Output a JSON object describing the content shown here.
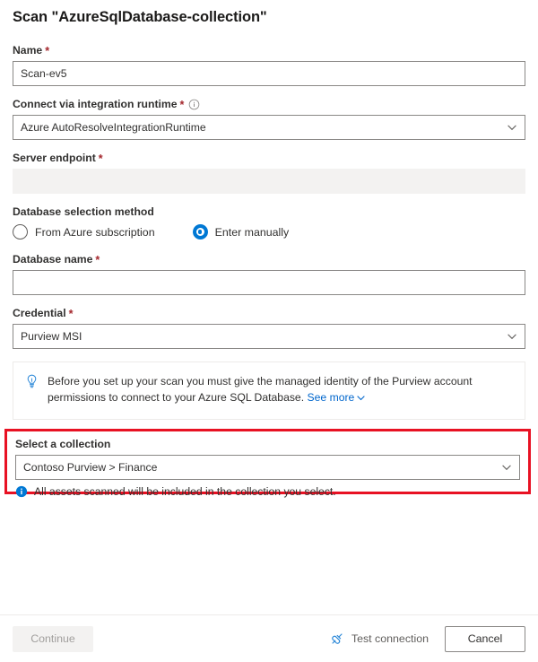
{
  "dialog": {
    "title": "Scan \"AzureSqlDatabase-collection\""
  },
  "fields": {
    "name": {
      "label": "Name",
      "required_mark": "*",
      "value": "Scan-ev5",
      "placeholder": ""
    },
    "integration_runtime": {
      "label": "Connect via integration runtime",
      "required_mark": "*",
      "info_icon": "info-circle-icon",
      "value": "Azure AutoResolveIntegrationRuntime",
      "chevron_icon": "chevron-down-icon"
    },
    "server_endpoint": {
      "label": "Server endpoint",
      "required_mark": "*",
      "value": "",
      "disabled": true
    },
    "database_selection_method": {
      "label": "Database selection method",
      "options": [
        {
          "label": "From Azure subscription",
          "selected": false
        },
        {
          "label": "Enter manually",
          "selected": true
        }
      ]
    },
    "database_name": {
      "label": "Database name",
      "required_mark": "*",
      "value": "",
      "placeholder": ""
    },
    "credential": {
      "label": "Credential",
      "required_mark": "*",
      "value": "Purview MSI",
      "chevron_icon": "chevron-down-icon"
    }
  },
  "tip": {
    "icon": "lightbulb-icon",
    "text": "Before you set up your scan you must give the managed identity of the Purview account permissions to connect to your Azure SQL Database.",
    "link_label": "See more",
    "link_chevron_icon": "chevron-down-icon"
  },
  "collection_section": {
    "label": "Select a collection",
    "value": "Contoso Purview > Finance",
    "chevron_icon": "chevron-down-icon",
    "note_icon": "info-filled-icon",
    "note_text": "All assets scanned will be included in the collection you select.",
    "highlight_color": "#e81123"
  },
  "footer": {
    "continue_label": "Continue",
    "continue_disabled": true,
    "test_connection_label": "Test connection",
    "test_connection_icon": "plug-icon",
    "cancel_label": "Cancel"
  },
  "colors": {
    "accent": "#0078d4",
    "link": "#0066cc",
    "required": "#a4262c",
    "highlight": "#e81123",
    "border": "#8a8886"
  }
}
